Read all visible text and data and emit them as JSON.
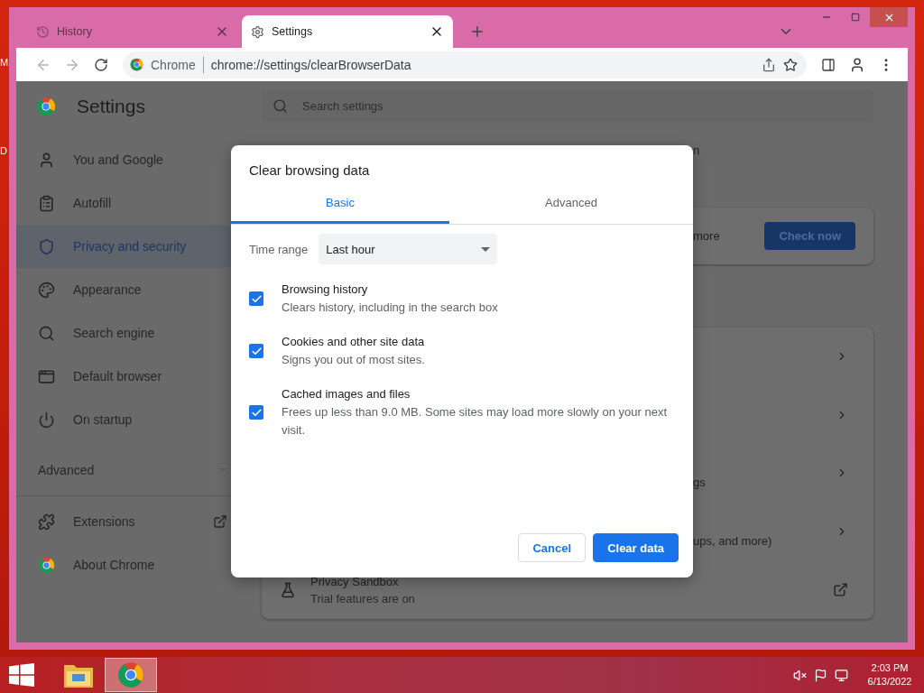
{
  "desktop": {
    "edge_labels": [
      "M",
      "D"
    ]
  },
  "browser": {
    "tabs": [
      {
        "title": "History",
        "selected": false
      },
      {
        "title": "Settings",
        "selected": true
      }
    ],
    "omnibox": {
      "chip": "Chrome",
      "url": "chrome://settings/clearBrowserData"
    }
  },
  "settings": {
    "title": "Settings",
    "search": {
      "placeholder": "Search settings"
    },
    "nav": [
      {
        "label": "You and Google",
        "selected": false
      },
      {
        "label": "Autofill",
        "selected": false
      },
      {
        "label": "Privacy and security",
        "selected": true
      },
      {
        "label": "Appearance",
        "selected": false
      },
      {
        "label": "Search engine",
        "selected": false
      },
      {
        "label": "Default browser",
        "selected": false
      },
      {
        "label": "On startup",
        "selected": false
      }
    ],
    "advanced": {
      "label": "Advanced",
      "expanded": false
    },
    "nav_links": [
      {
        "label": "Extensions"
      },
      {
        "label": "About Chrome"
      }
    ],
    "section_heading": "n",
    "safety_card": {
      "text": "more",
      "button": "Check now"
    },
    "privacy_rows": [
      {
        "kind": "chevron"
      },
      {
        "kind": "chevron"
      },
      {
        "kind": "chevron",
        "text": "gs"
      },
      {
        "kind": "chevron",
        "text": "ups, and more)"
      },
      {
        "kind": "external",
        "title": "Privacy Sandbox",
        "subtitle": "Trial features are on"
      }
    ]
  },
  "dialog": {
    "title": "Clear browsing data",
    "tabs": [
      {
        "label": "Basic",
        "selected": true
      },
      {
        "label": "Advanced",
        "selected": false
      }
    ],
    "time_range": {
      "label": "Time range",
      "value": "Last hour"
    },
    "options": [
      {
        "title": "Browsing history",
        "description": "Clears history, including in the search box",
        "checked": true
      },
      {
        "title": "Cookies and other site data",
        "description": "Signs you out of most sites.",
        "checked": true
      },
      {
        "title": "Cached images and files",
        "description": "Frees up less than 9.0 MB. Some sites may load more slowly on your next visit.",
        "checked": true
      }
    ],
    "buttons": [
      {
        "label": "Cancel",
        "kind": "secondary"
      },
      {
        "label": "Clear data",
        "kind": "primary"
      }
    ]
  },
  "taskbar": {
    "apps": [
      {
        "active": false
      },
      {
        "active": true
      }
    ],
    "time": "2:03 PM",
    "date": "6/13/2022"
  }
}
